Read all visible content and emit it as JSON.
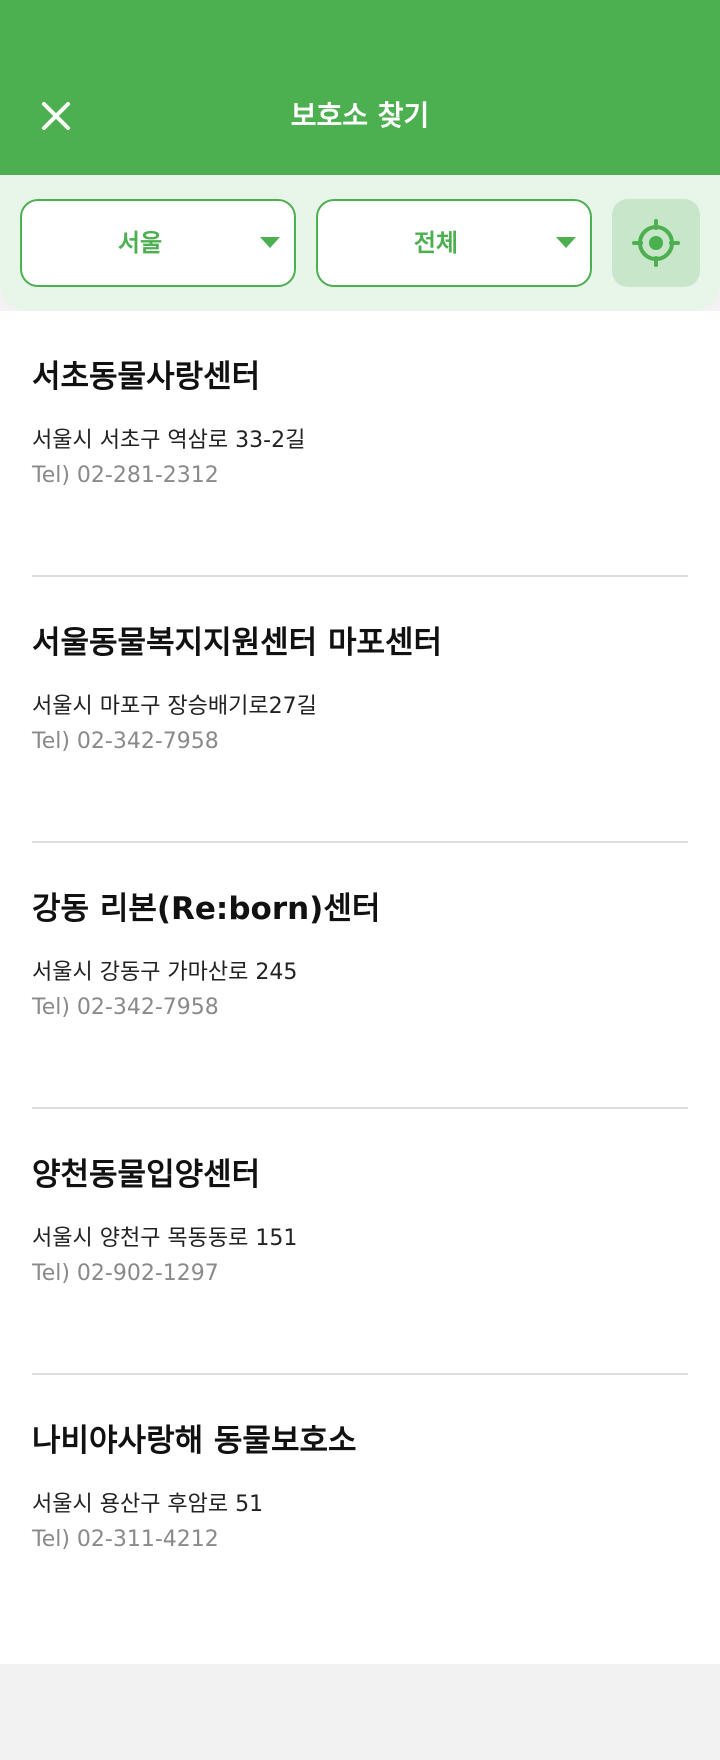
{
  "header": {
    "title": "보호소 찾기",
    "close_icon": "close-icon"
  },
  "filters": {
    "region": "서울",
    "type": "전체",
    "locate_icon": "location-target-icon"
  },
  "shelters": [
    {
      "name": "서초동물사랑센터",
      "address": "서울시 서초구 역삼로 33-2길",
      "tel": "Tel) 02-281-2312"
    },
    {
      "name": "서울동물복지지원센터 마포센터",
      "address": "서울시 마포구 장승배기로27길",
      "tel": "Tel) 02-342-7958"
    },
    {
      "name": "강동 리본(Re:born)센터",
      "address": "서울시 강동구 가마산로 245",
      "tel": "Tel) 02-342-7958"
    },
    {
      "name": "양천동물입양센터",
      "address": "서울시 양천구 목동동로 151",
      "tel": "Tel) 02-902-1297"
    },
    {
      "name": "나비야사랑해 동물보호소",
      "address": "서울시 용산구 후암로 51",
      "tel": "Tel) 02-311-4212"
    }
  ],
  "colors": {
    "brand": "#4caf50",
    "filter_bg": "#e8f5e9",
    "locate_bg": "#c8e6c9",
    "footer_bg": "#f2f2f2"
  }
}
